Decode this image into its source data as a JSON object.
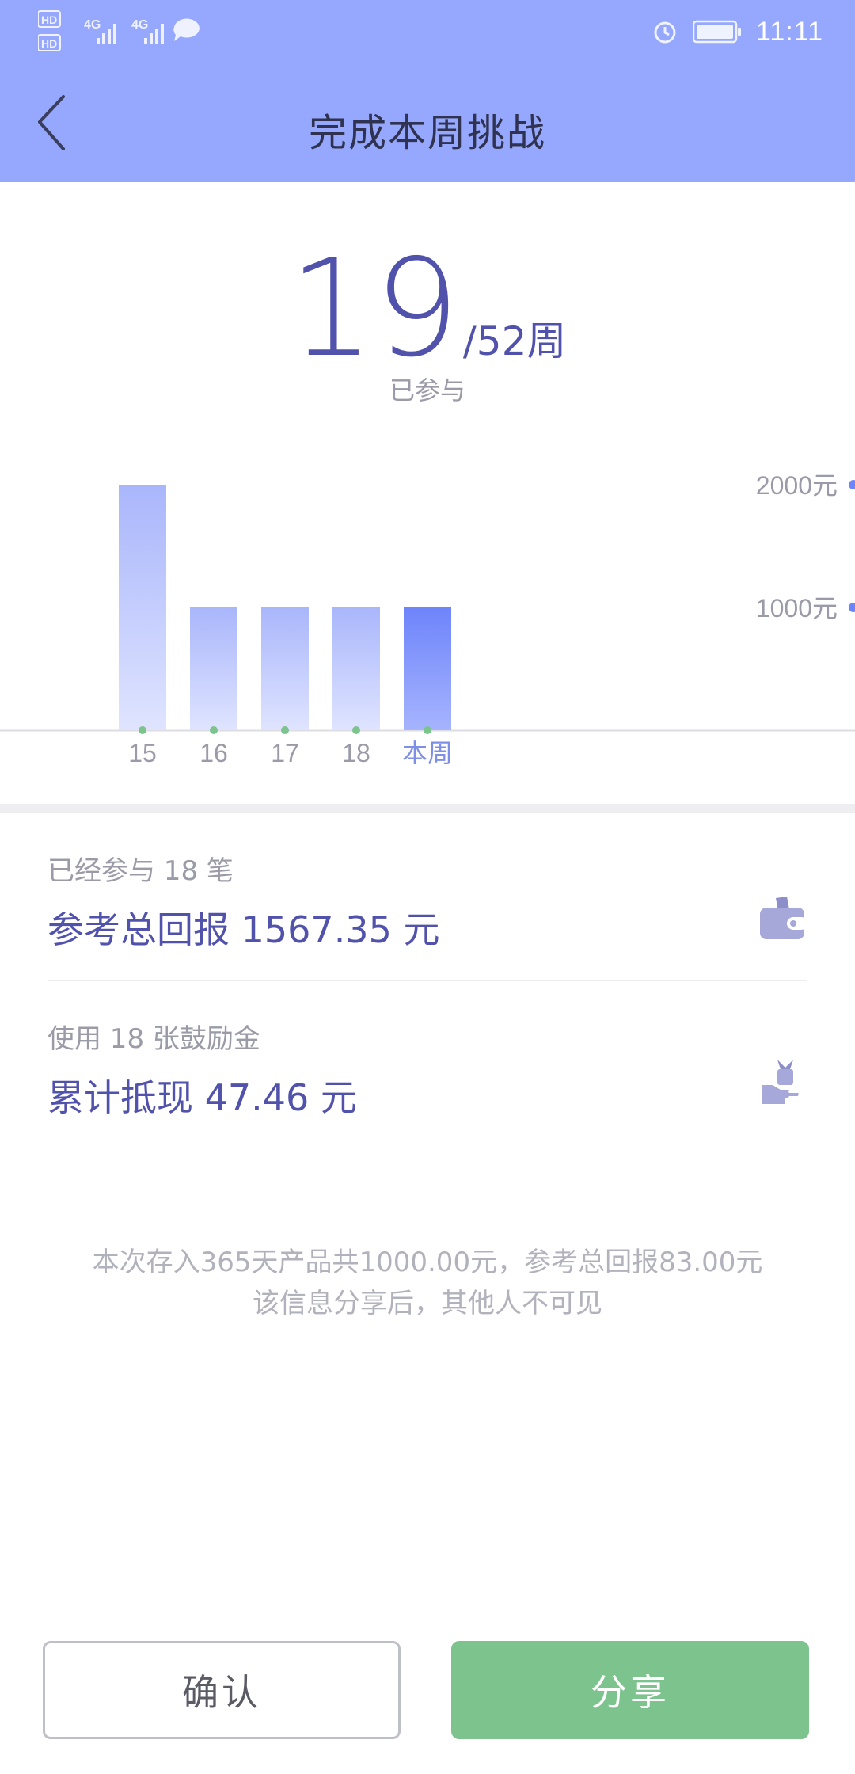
{
  "status_bar": {
    "time": "11:11",
    "sim1_label": "HD",
    "sim2_label": "HD",
    "network1": "4G",
    "network2": "4G"
  },
  "header": {
    "title": "完成本周挑战"
  },
  "hero": {
    "count": "19",
    "total": "/52周",
    "caption": "已参与"
  },
  "chart_data": {
    "type": "bar",
    "categories": [
      "15",
      "16",
      "17",
      "18",
      "本周"
    ],
    "values": [
      2000,
      1000,
      1000,
      1000,
      1000
    ],
    "highlight_index": 4,
    "y_ticks": [
      "2000元",
      "1000元"
    ],
    "ylim": [
      0,
      2000
    ],
    "colors": {
      "bar_top": "#a9b6fb",
      "bar_bottom": "#dfe4ff",
      "current_top": "#6e84fb",
      "current_bottom": "#a6b4fd",
      "dot": "#7dc38e",
      "current_label": "#7e8fe8",
      "label": "#9a9aa8"
    }
  },
  "records": {
    "participation": {
      "subtitle": "已经参与 18 笔",
      "title": "参考总回报 1567.35 元",
      "icon": "wallet-icon"
    },
    "vouchers": {
      "subtitle": "使用 18 张鼓励金",
      "title": "累计抵现 47.46 元",
      "icon": "cash-hand-icon"
    }
  },
  "note": {
    "line1": "本次存入365天产品共1000.00元，参考总回报83.00元",
    "line2": "该信息分享后，其他人不可见"
  },
  "buttons": {
    "confirm": "确认",
    "share": "分享"
  }
}
